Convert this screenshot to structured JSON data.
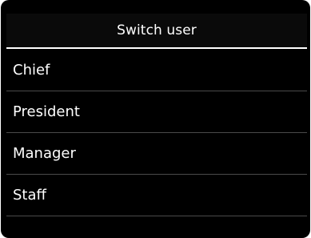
{
  "header": {
    "title": "Switch user"
  },
  "users": [
    {
      "label": "Chief"
    },
    {
      "label": "President"
    },
    {
      "label": "Manager"
    },
    {
      "label": "Staff"
    }
  ]
}
